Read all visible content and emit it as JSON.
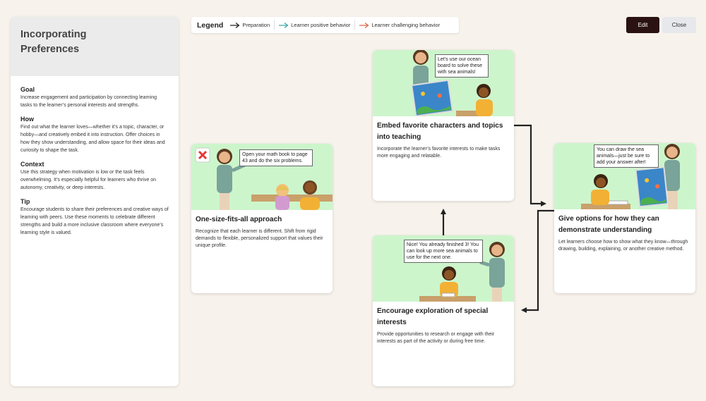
{
  "sidebar": {
    "title": "Incorporating Preferences",
    "sections": [
      {
        "heading": "Goal",
        "text": "Increase engagement and participation by connecting learning tasks to the learner’s personal interests and strengths."
      },
      {
        "heading": "How",
        "text": "Find out what the learner loves—whether it’s a topic, character, or hobby—and creatively embed it into instruction. Offer choices in how they show understanding, and allow space for their ideas and curiosity to shape the task."
      },
      {
        "heading": "Context",
        "text": "Use this strategy when motivation is low or the task feels overwhelming. It’s especially helpful for learners who thrive on autonomy, creativity, or deep interests."
      },
      {
        "heading": "Tip",
        "text": "Encourage students to share their preferences and creative ways of learning with peers. Use these moments to celebrate different strengths and build a more inclusive classroom where everyone’s learning style is valued."
      }
    ]
  },
  "legend": {
    "title": "Legend",
    "items": [
      {
        "label": "Preparation",
        "color": "#222222"
      },
      {
        "label": "Learner positive behavior",
        "color": "#3aa6a6"
      },
      {
        "label": "Learner challenging behavior",
        "color": "#e0654a"
      }
    ]
  },
  "buttons": {
    "edit": "Edit",
    "close": "Close"
  },
  "cards": [
    {
      "title": "One-size-fits-all approach",
      "text": "Recognize that each learner is different. Shift from rigid demands to flexible, personalized support that values their unique profile.",
      "bubble": "Open your math book to page 43 and do the six problems."
    },
    {
      "title": "Embed favorite characters and topics into teaching",
      "text": "Incorporate the learner’s favorite interests to make tasks more engaging and relatable.",
      "bubble": "Let’s use our ocean board to solve these with sea animals!"
    },
    {
      "title": "Encourage exploration of special interests",
      "text": "Provide opportunities to research or engage with their interests as part of the activity or during free time.",
      "bubble": "Nice! You already finished 3! You can look up more sea animals to use for the next one."
    },
    {
      "title": "Give options for how they can demonstrate understanding",
      "text": "Let learners choose how to show what they know—through drawing, building, explaining, or another creative method.",
      "bubble": "You can draw the sea animals—just be sure to add your answer after!"
    }
  ],
  "colors": {
    "accent_dark": "#2a1212",
    "illustration_bg": "#cdf5cc",
    "canvas_bg": "#f7f3ec"
  }
}
